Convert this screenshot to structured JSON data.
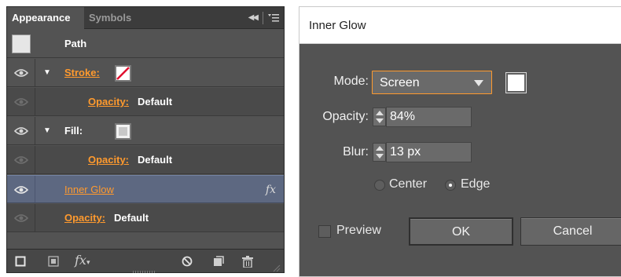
{
  "appearance_panel": {
    "tabs": [
      {
        "label": "Appearance",
        "active": true
      },
      {
        "label": "Symbols",
        "active": false
      }
    ],
    "rows": {
      "path": {
        "label": "Path"
      },
      "stroke": {
        "label": "Stroke:",
        "swatch": "none (red slash)"
      },
      "stroke_opacity": {
        "link": "Opacity:",
        "value": "Default"
      },
      "fill": {
        "label": "Fill:",
        "swatch": "light gray"
      },
      "fill_opacity": {
        "link": "Opacity:",
        "value": "Default"
      },
      "inner_glow": {
        "label": "Inner Glow",
        "fx": "fx",
        "selected": true
      },
      "opacity": {
        "link": "Opacity:",
        "value": "Default"
      }
    },
    "bottom_icons": [
      "add-new-stroke-icon",
      "add-new-fill-icon",
      "fx-menu-icon",
      "clear-appearance-icon",
      "duplicate-item-icon",
      "delete-item-icon"
    ],
    "bottom_fx_label": "fx"
  },
  "inner_glow_dialog": {
    "title": "Inner Glow",
    "mode": {
      "label": "Mode:",
      "value": "Screen",
      "color": "#ffffff"
    },
    "opacity": {
      "label": "Opacity:",
      "value": "84%"
    },
    "blur": {
      "label": "Blur:",
      "value": "13 px"
    },
    "source": {
      "options": [
        "Center",
        "Edge"
      ],
      "center_label": "Center",
      "edge_label": "Edge",
      "selected": "Edge"
    },
    "preview": {
      "label": "Preview",
      "checked": false
    },
    "ok_label": "OK",
    "cancel_label": "Cancel"
  },
  "colors": {
    "panel_bg": "#535353",
    "accent_orange": "#ff9a2e",
    "selection_blue": "#5d6881"
  }
}
